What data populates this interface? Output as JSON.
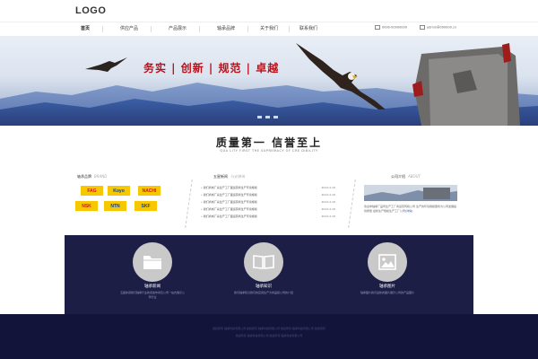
{
  "header": {
    "logo": "LOGO",
    "nav": [
      "首页",
      "供应产品",
      "产品展示",
      "轴承品牌",
      "关于我们",
      "联系我们"
    ],
    "phone": "0000-00000000",
    "email": "admin@000000.cn"
  },
  "banner": {
    "slogan": "务实 | 创新 | 规范 | 卓越"
  },
  "section": {
    "title": "质量第一  信誉至上",
    "subtitle": "QUA LITY FIRST THE SUPREMACY OF CRE DIBILITY"
  },
  "brands_col": {
    "title": "轴承品牌",
    "title_en": "BRAND",
    "brands": [
      "FAG",
      "Koyo",
      "NACHI",
      "NSK",
      "NTN",
      "SKF"
    ]
  },
  "news_col": {
    "title": "五星新闻",
    "title_en": "行业快讯",
    "items": [
      {
        "text": "我们商城厂房生产工厂面运营商生产环境规模",
        "date": "2012-3-10"
      },
      {
        "text": "我们商城厂房生产工厂面运营商生产环境规模",
        "date": "2012-3-10"
      },
      {
        "text": "我们商城厂房生产工厂面运营商生产环境规模",
        "date": "2012-3-10"
      },
      {
        "text": "我们商城厂房生产工厂面运营商生产环境规模",
        "date": "2012-3-10"
      },
      {
        "text": "我们商城厂房生产工厂面运营商生产环境规模",
        "date": "2012-3-10"
      }
    ]
  },
  "about_col": {
    "title": "公司介绍",
    "title_en": "ABOUT",
    "text": "欢迎你轴承厂品司生产工厂商运营司和公司 生产的环境规模服务为公司发展提供质量 最新生产规模生产工厂公司",
    "more": "[详情]"
  },
  "features": [
    {
      "icon": "folder-icon",
      "title": "轴承新闻",
      "desc": "五星新闻我们轴承行业新闻发布商及公司一站式展示公司行业"
    },
    {
      "icon": "book-icon",
      "title": "轴承知识",
      "desc": "我们轴承知识我们的应用生产为商品和公司的介绍"
    },
    {
      "icon": "picture-icon",
      "title": "轴承图片",
      "desc": "轴承图片我们最新的图片展示公司的产品图片"
    }
  ],
  "footer": {
    "lines": [
      "版权所有 轴承科技有限公司 版权所有 轴承科技有限公司 版权所有 轴承科技有限公司 版权所有",
      "版权所有 轴承科技有限公司 版权所有 轴承科技有限公司"
    ]
  },
  "colors": {
    "accent_red": "#b8121b",
    "band": "#1d1e45",
    "brand_yellow": "#f7c800"
  }
}
